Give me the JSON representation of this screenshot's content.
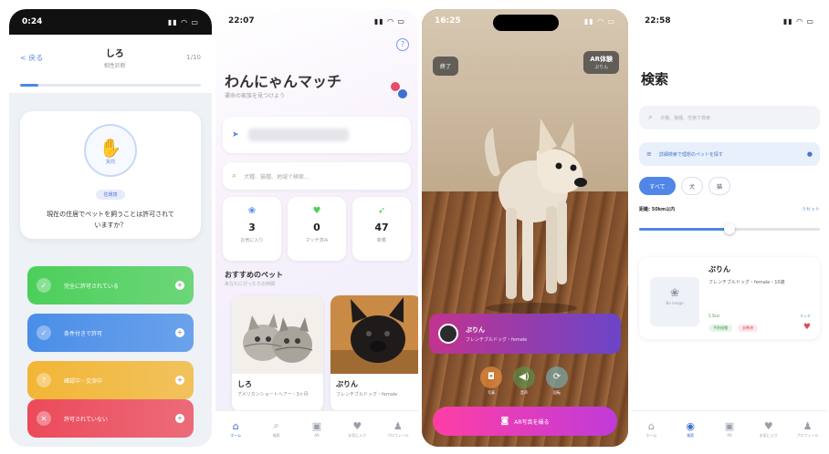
{
  "screen1": {
    "status_time": "0:24",
    "back_label": "< 戻る",
    "title": "しろ",
    "subtitle": "相性診断",
    "counter": "1/10",
    "progress": 0.1,
    "question_icon_label": "質問",
    "category_badge": "住環境",
    "question": "現在の住居でペットを飼うことは許可されていますか？",
    "options": [
      {
        "label": "完全に許可されている",
        "color": "#4ccf5a"
      },
      {
        "label": "条件付きで許可",
        "color": "#4a8ee8"
      },
      {
        "label": "確認中・交渉中",
        "color": "#f2b636"
      },
      {
        "label": "許可されていない",
        "color": "#ec4a5a"
      }
    ]
  },
  "screen2": {
    "status_time": "22:07",
    "app_title": "わんにゃんマッチ",
    "app_subtitle": "運命の家族を見つけよう",
    "search_placeholder": "犬種、猫種、地域で検索...",
    "stats": [
      {
        "value": "3",
        "label": "お気に入り",
        "icon": "paw-icon",
        "color": "#4f86e8"
      },
      {
        "value": "0",
        "label": "マッチ済み",
        "icon": "heart-icon",
        "color": "#4ccf5a"
      },
      {
        "value": "47",
        "label": "新着",
        "icon": "send-icon",
        "color": "#4ccf5a"
      }
    ],
    "section_title": "おすすめのペット",
    "section_subtitle": "あなたにぴったりの仲間",
    "pets": [
      {
        "name": "しろ",
        "breed": "アメリカンショートヘアー・3ヶ月"
      },
      {
        "name": "ぷりん",
        "breed": "フレンチブルドッグ・female"
      }
    ],
    "tabs": [
      {
        "label": "ホーム",
        "icon": "home-icon",
        "active": true
      },
      {
        "label": "検索",
        "icon": "search-icon",
        "active": false
      },
      {
        "label": "AR",
        "icon": "ar-icon",
        "active": false
      },
      {
        "label": "お気に入り",
        "icon": "heart-icon",
        "active": false
      },
      {
        "label": "プロフィール",
        "icon": "user-icon",
        "active": false
      }
    ]
  },
  "screen3": {
    "status_time": "16:25",
    "done_label": "終了",
    "ar_mode_title": "AR体験",
    "ar_mode_subtitle": "ぷりん",
    "pet_name": "ぷりん",
    "pet_breed": "フレンチブルドッグ・female",
    "controls": [
      {
        "label": "写真",
        "icon": "camera-icon"
      },
      {
        "label": "音声",
        "icon": "speaker-icon"
      },
      {
        "label": "回転",
        "icon": "rotate-icon"
      }
    ],
    "photo_button": "AR写真を撮る"
  },
  "screen4": {
    "status_time": "22:58",
    "title": "検索",
    "search_placeholder": "犬種、猫種、性格で検索",
    "banner_text": "詳細検索で理想のペットを探す",
    "chips": [
      {
        "label": "すべて",
        "on": true
      },
      {
        "label": "犬",
        "on": false
      },
      {
        "label": "猫",
        "on": false
      }
    ],
    "distance_label": "距離: 50km以内",
    "distance_reset": "リセット",
    "distance_fraction": 0.5,
    "result": {
      "name": "ぷりん",
      "breed": "フレンチブルドッグ・female・10歳",
      "image_text": "No image",
      "location": "5.5km",
      "tags": [
        "予防接種",
        "去勢済"
      ],
      "note": "マッチ"
    },
    "tabs": [
      {
        "label": "ホーム",
        "icon": "home-icon",
        "active": false
      },
      {
        "label": "検索",
        "icon": "search-icon",
        "active": true
      },
      {
        "label": "AR",
        "icon": "ar-icon",
        "active": false
      },
      {
        "label": "お気に入り",
        "icon": "heart-icon",
        "active": false
      },
      {
        "label": "プロフィール",
        "icon": "user-icon",
        "active": false
      }
    ]
  }
}
